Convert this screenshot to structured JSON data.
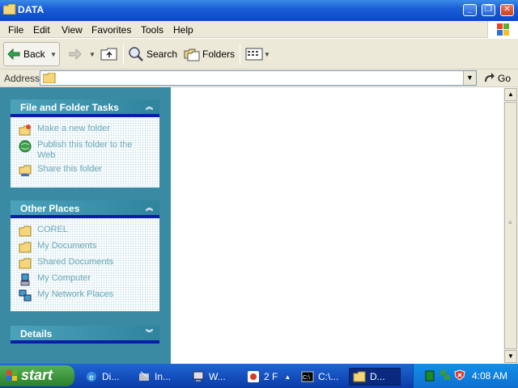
{
  "window": {
    "title": "DATA"
  },
  "menu": [
    "File",
    "Edit",
    "View",
    "Favorites",
    "Tools",
    "Help"
  ],
  "toolbar": {
    "back": "Back",
    "search": "Search",
    "folders": "Folders"
  },
  "address": {
    "label": "Address",
    "value": "",
    "go": "Go"
  },
  "tasks_panel": {
    "title": "File and Folder Tasks",
    "items": [
      "Make a new folder",
      "Publish this folder to the Web",
      "Share this folder"
    ]
  },
  "other_places": {
    "title": "Other Places",
    "items": [
      "COREL",
      "My Documents",
      "Shared Documents",
      "My Computer",
      "My Network Places"
    ]
  },
  "details": {
    "title": "Details"
  },
  "taskbar": {
    "start": "start",
    "items": [
      "Di...",
      "In...",
      "W...",
      "2 F",
      "C:\\...",
      "D..."
    ],
    "clock": "4:08 AM"
  },
  "colors": {
    "titlebar": "#0b47c8",
    "taskpane": "#3a8aa3",
    "taskbar": "#1f66d4",
    "start": "#3a9a3a"
  }
}
